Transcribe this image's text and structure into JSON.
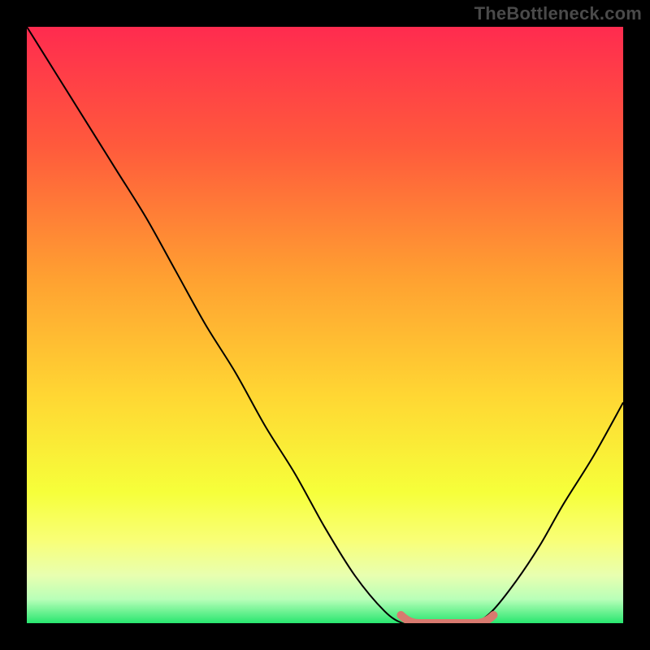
{
  "watermark": "TheBottleneck.com",
  "chart_data": {
    "type": "line",
    "title": "",
    "xlabel": "",
    "ylabel": "",
    "xlim": [
      0,
      100
    ],
    "ylim": [
      0,
      100
    ],
    "x": [
      0,
      5,
      10,
      15,
      20,
      25,
      30,
      35,
      40,
      45,
      50,
      55,
      60,
      63,
      65,
      68,
      72,
      75,
      78,
      82,
      86,
      90,
      95,
      100
    ],
    "values": [
      100,
      92,
      84,
      76,
      68,
      59,
      50,
      42,
      33,
      25,
      16,
      8,
      2,
      0,
      0,
      0,
      0,
      0,
      2,
      7,
      13,
      20,
      28,
      37
    ],
    "highlight_segment": {
      "x_start": 63,
      "x_end": 78,
      "y": 0
    },
    "background_gradient": {
      "stops": [
        {
          "offset": 0.0,
          "color": "#ff2b4f"
        },
        {
          "offset": 0.2,
          "color": "#ff5a3c"
        },
        {
          "offset": 0.42,
          "color": "#ffa031"
        },
        {
          "offset": 0.62,
          "color": "#ffd733"
        },
        {
          "offset": 0.78,
          "color": "#f6ff3a"
        },
        {
          "offset": 0.86,
          "color": "#f9ff76"
        },
        {
          "offset": 0.92,
          "color": "#e8ffb0"
        },
        {
          "offset": 0.96,
          "color": "#b8ffb8"
        },
        {
          "offset": 1.0,
          "color": "#28e66f"
        }
      ]
    }
  }
}
